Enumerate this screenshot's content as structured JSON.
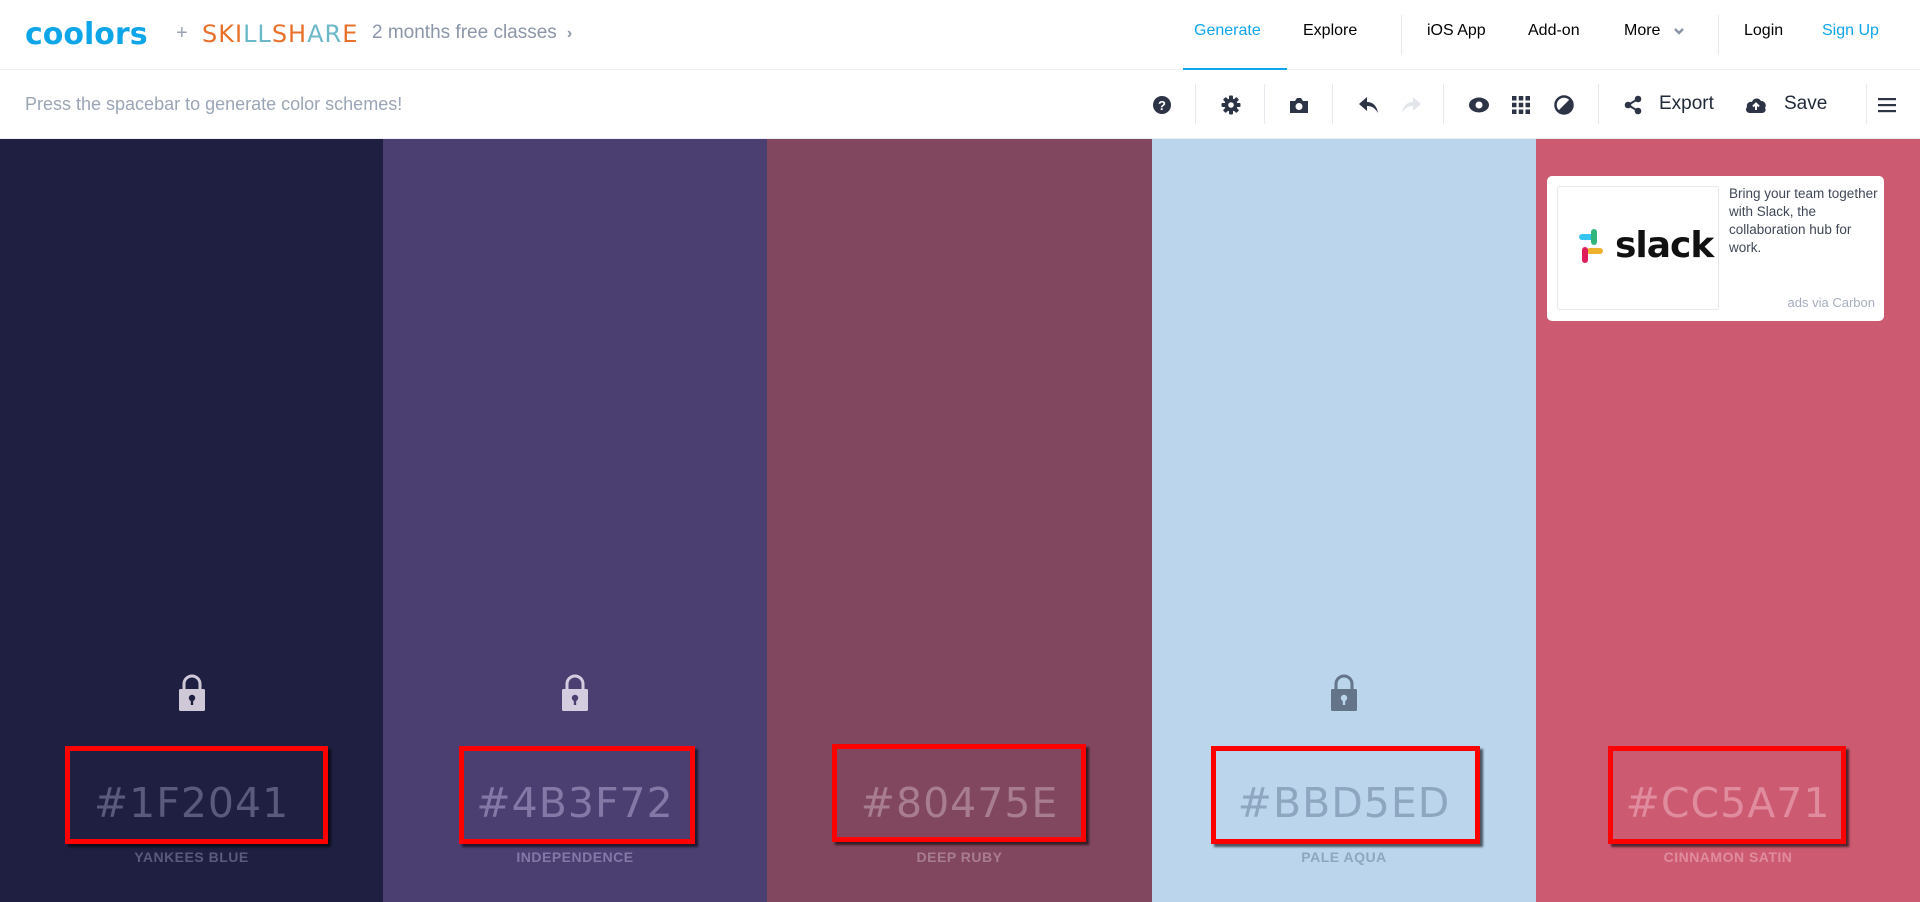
{
  "header": {
    "logo": "coolors",
    "plus": "+",
    "partner_a": "SKI",
    "partner_b": "LL",
    "partner_c": "SH",
    "partner_d": "AR",
    "partner_e": "E",
    "promo": "2 months free classes",
    "promo_chevron": "›",
    "nav": {
      "generate": "Generate",
      "explore": "Explore",
      "ios_app": "iOS App",
      "addon": "Add-on",
      "more": "More",
      "login": "Login",
      "signup": "Sign Up"
    },
    "active_nav": "Generate"
  },
  "toolbar": {
    "hint": "Press the spacebar to generate color schemes!",
    "icons": [
      "help-icon",
      "settings-icon",
      "camera-icon",
      "undo-icon",
      "redo-icon",
      "eye-icon",
      "grid-icon",
      "contrast-icon",
      "share-icon",
      "cloud-upload-icon",
      "menu-icon"
    ],
    "export_label": "Export",
    "save_label": "Save"
  },
  "palette": [
    {
      "hex": "#1F2041",
      "name": "YANKEES BLUE",
      "color": "#1f2041",
      "text_color": "#5a5a7d",
      "lock_color": "#cfc8d6",
      "locked": true
    },
    {
      "hex": "#4B3F72",
      "name": "INDEPENDENCE",
      "color": "#4b3f72",
      "text_color": "#8378a6",
      "lock_color": "#d4cde0",
      "locked": true
    },
    {
      "hex": "#80475E",
      "name": "DEEP RUBY",
      "color": "#80475e",
      "text_color": "#a97d90",
      "lock_color": null,
      "locked": false
    },
    {
      "hex": "#BBD5ED",
      "name": "PALE AQUA",
      "color": "#bbd5ed",
      "text_color": "#8ea6bf",
      "lock_color": "#647489",
      "locked": true
    },
    {
      "hex": "#CC5A71",
      "name": "CINNAMON SATIN",
      "color": "#cc5a71",
      "text_color": "#e08c9e",
      "lock_color": null,
      "locked": false
    }
  ],
  "ad": {
    "brand": "slack",
    "text": "Bring your team together with Slack, the collaboration hub for work.",
    "via": "ads via Carbon"
  },
  "colors": {
    "accent": "#0ea5e9",
    "nav_text": "#8b96a8",
    "highlight_box": "#ff0000"
  }
}
